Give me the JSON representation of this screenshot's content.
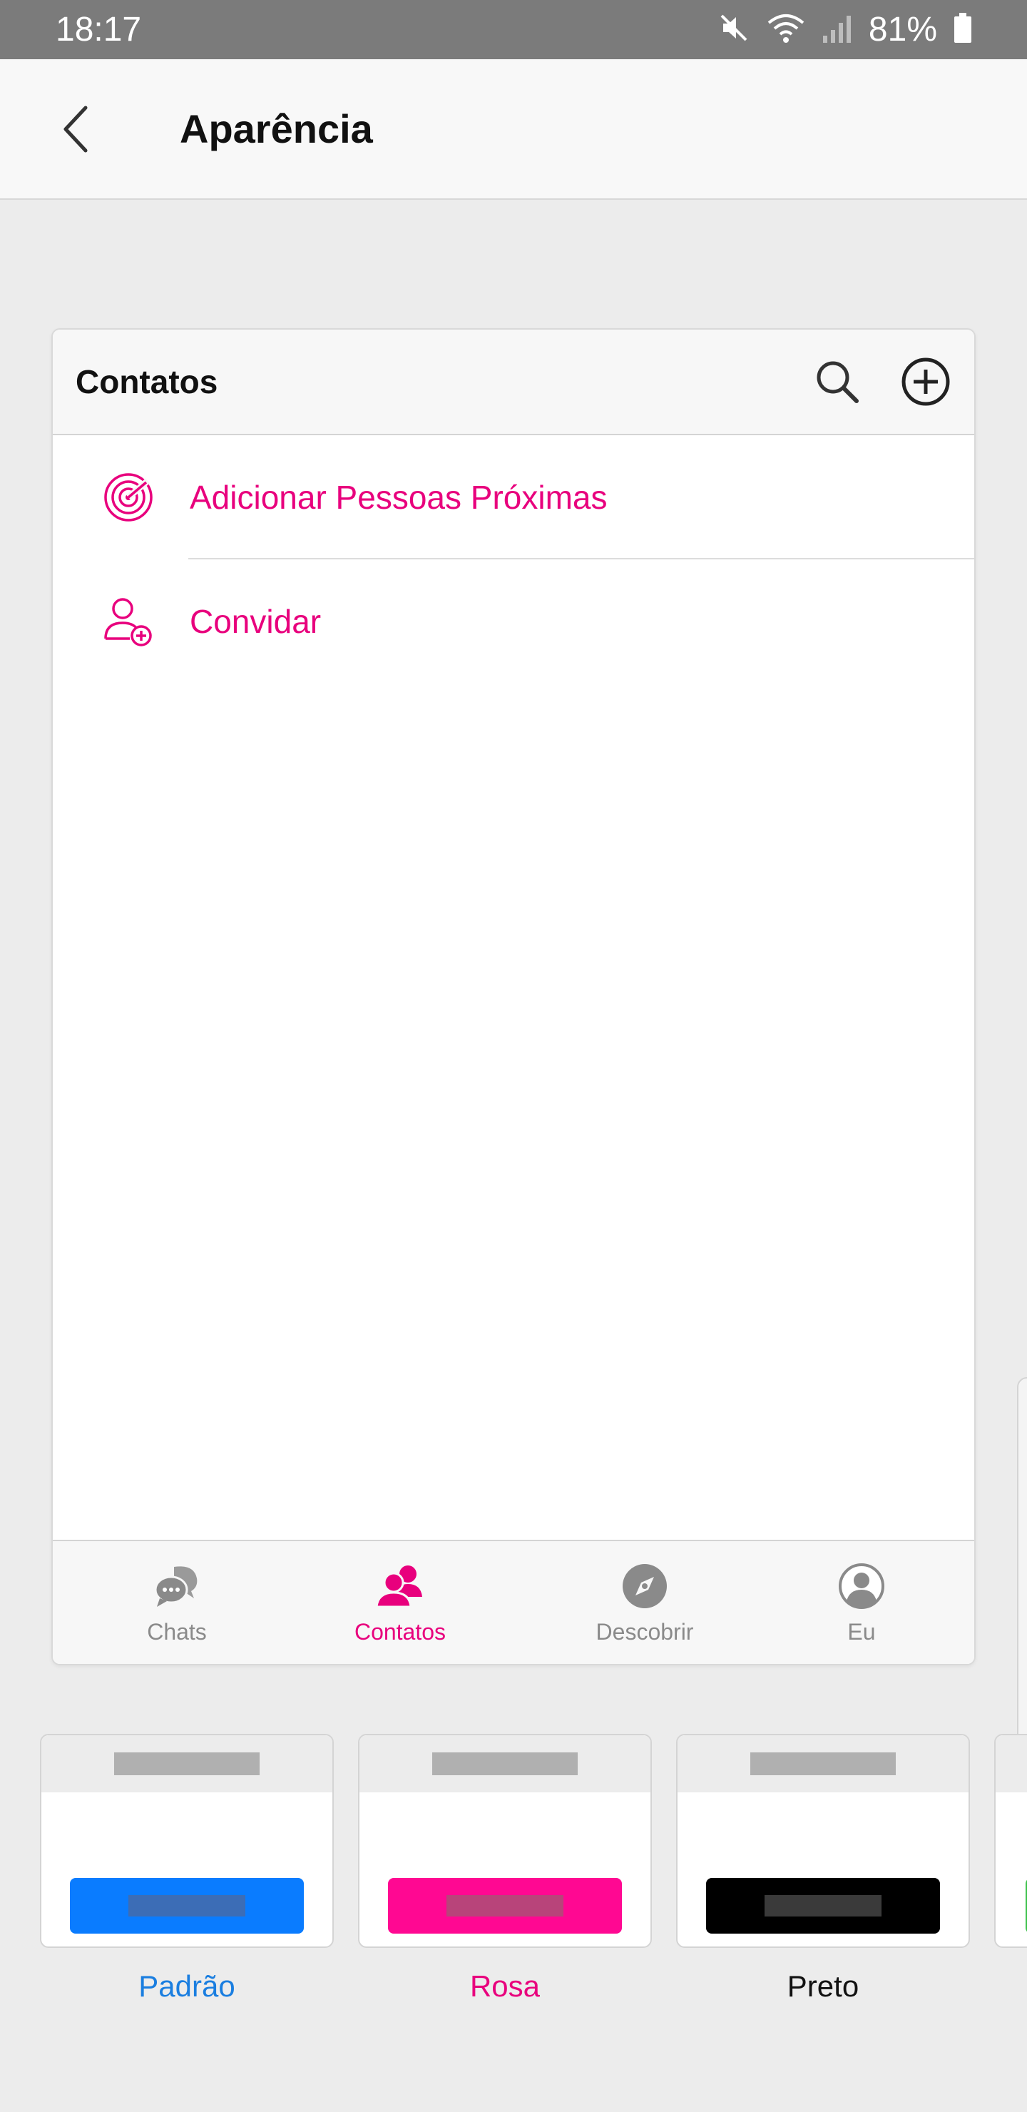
{
  "status_bar": {
    "time": "18:17",
    "battery": "81%"
  },
  "app_bar": {
    "title": "Aparência"
  },
  "preview": {
    "header_title": "Contatos",
    "items": [
      {
        "label": "Adicionar Pessoas Próximas",
        "icon": "radar-icon"
      },
      {
        "label": "Convidar",
        "icon": "add-person-icon"
      }
    ],
    "tabs": [
      {
        "label": "Chats",
        "icon": "chat-bubbles-icon",
        "active": false
      },
      {
        "label": "Contatos",
        "icon": "contacts-icon",
        "active": true
      },
      {
        "label": "Descobrir",
        "icon": "compass-icon",
        "active": false
      },
      {
        "label": "Eu",
        "icon": "profile-icon",
        "active": false
      }
    ],
    "accent_color": "#e8007d"
  },
  "themes": [
    {
      "label": "Padrão",
      "color": "#0a7cff",
      "label_color": "#1a7ee0"
    },
    {
      "label": "Rosa",
      "color": "#ff0892",
      "label_color": "#e8007d"
    },
    {
      "label": "Preto",
      "color": "#000000",
      "label_color": "#111111"
    }
  ]
}
